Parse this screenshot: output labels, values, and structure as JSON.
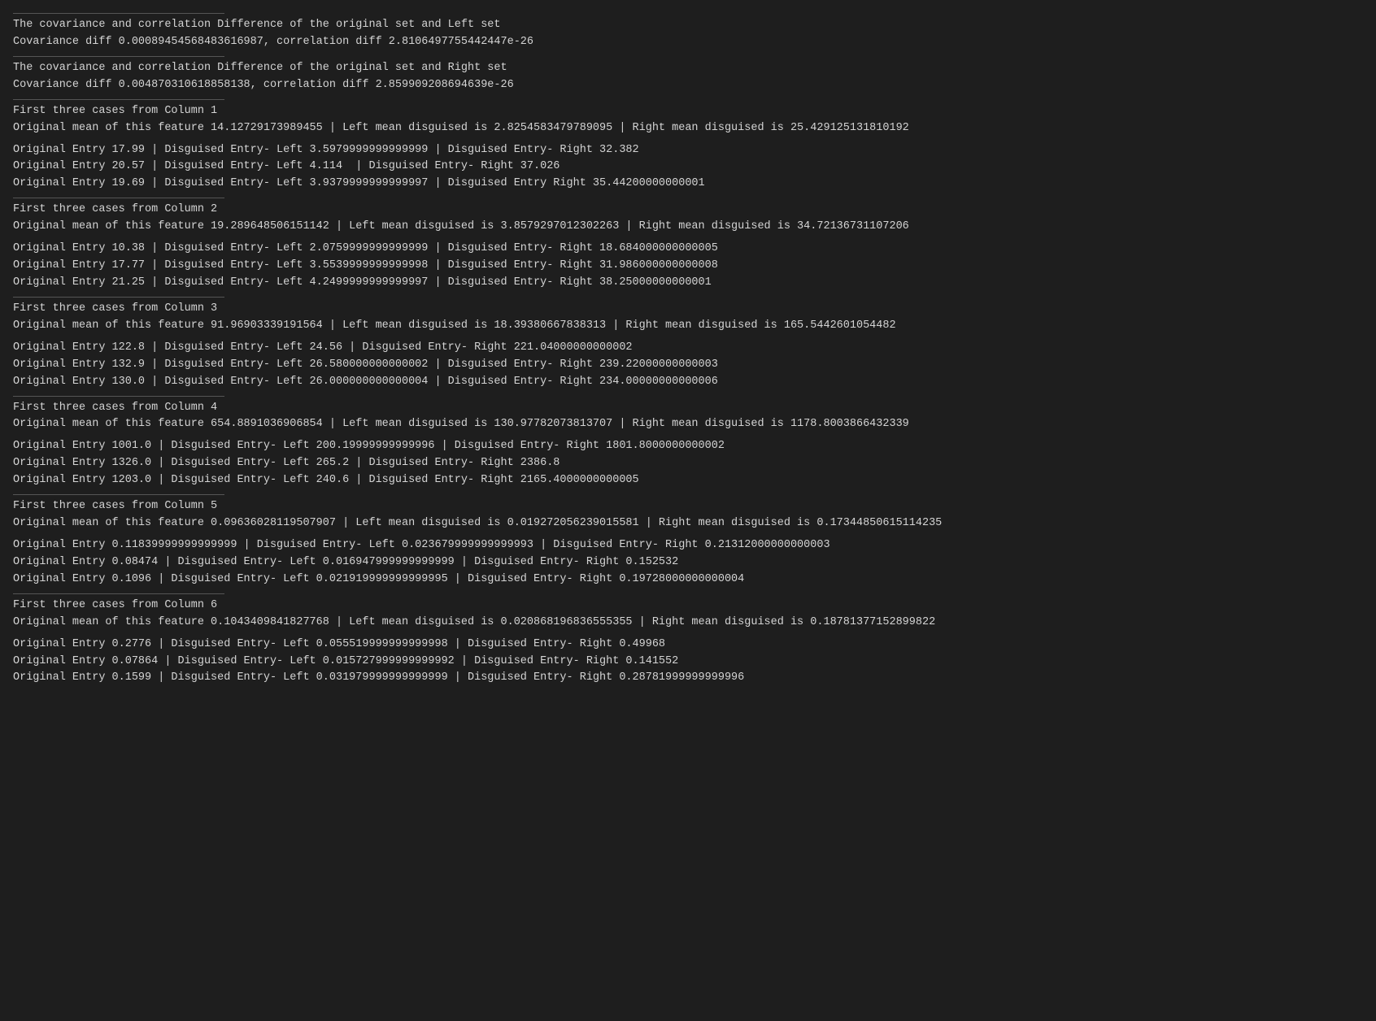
{
  "content": [
    {
      "type": "divider"
    },
    {
      "type": "line",
      "text": "The covariance and correlation Difference of the original set and Left set"
    },
    {
      "type": "line",
      "text": "Covariance diff 0.00089454568483616987, correlation diff 2.8106497755442447e-26"
    },
    {
      "type": "divider"
    },
    {
      "type": "line",
      "text": "The covariance and correlation Difference of the original set and Right set"
    },
    {
      "type": "line",
      "text": "Covariance diff 0.004870310618858138, correlation diff 2.859909208694639e-26"
    },
    {
      "type": "divider"
    },
    {
      "type": "line",
      "text": "First three cases from Column 1"
    },
    {
      "type": "line",
      "text": "Original mean of this feature 14.12729173989455 | Left mean disguised is 2.8254583479789095 | Right mean disguised is 25.429125131810192"
    },
    {
      "type": "gap"
    },
    {
      "type": "line",
      "text": "Original Entry 17.99 | Disguised Entry- Left 3.5979999999999999 | Disguised Entry- Right 32.382"
    },
    {
      "type": "line",
      "text": "Original Entry 20.57 | Disguised Entry- Left 4.114  | Disguised Entry- Right 37.026"
    },
    {
      "type": "line",
      "text": "Original Entry 19.69 | Disguised Entry- Left 3.9379999999999997 | Disguised Entry Right 35.44200000000001"
    },
    {
      "type": "divider"
    },
    {
      "type": "line",
      "text": "First three cases from Column 2"
    },
    {
      "type": "line",
      "text": "Original mean of this feature 19.289648506151142 | Left mean disguised is 3.8579297012302263 | Right mean disguised is 34.72136731107206"
    },
    {
      "type": "gap"
    },
    {
      "type": "line",
      "text": "Original Entry 10.38 | Disguised Entry- Left 2.0759999999999999 | Disguised Entry- Right 18.684000000000005"
    },
    {
      "type": "line",
      "text": "Original Entry 17.77 | Disguised Entry- Left 3.5539999999999998 | Disguised Entry- Right 31.986000000000008"
    },
    {
      "type": "line",
      "text": "Original Entry 21.25 | Disguised Entry- Left 4.2499999999999997 | Disguised Entry- Right 38.25000000000001"
    },
    {
      "type": "divider"
    },
    {
      "type": "line",
      "text": "First three cases from Column 3"
    },
    {
      "type": "line",
      "text": "Original mean of this feature 91.96903339191564 | Left mean disguised is 18.39380667838313 | Right mean disguised is 165.5442601054482"
    },
    {
      "type": "gap"
    },
    {
      "type": "line",
      "text": "Original Entry 122.8 | Disguised Entry- Left 24.56 | Disguised Entry- Right 221.04000000000002"
    },
    {
      "type": "line",
      "text": "Original Entry 132.9 | Disguised Entry- Left 26.580000000000002 | Disguised Entry- Right 239.22000000000003"
    },
    {
      "type": "line",
      "text": "Original Entry 130.0 | Disguised Entry- Left 26.000000000000004 | Disguised Entry- Right 234.00000000000006"
    },
    {
      "type": "divider"
    },
    {
      "type": "line",
      "text": "First three cases from Column 4"
    },
    {
      "type": "line",
      "text": "Original mean of this feature 654.8891036906854 | Left mean disguised is 130.97782073813707 | Right mean disguised is 1178.8003866432339"
    },
    {
      "type": "gap"
    },
    {
      "type": "line",
      "text": "Original Entry 1001.0 | Disguised Entry- Left 200.19999999999996 | Disguised Entry- Right 1801.8000000000002"
    },
    {
      "type": "line",
      "text": "Original Entry 1326.0 | Disguised Entry- Left 265.2 | Disguised Entry- Right 2386.8"
    },
    {
      "type": "line",
      "text": "Original Entry 1203.0 | Disguised Entry- Left 240.6 | Disguised Entry- Right 2165.4000000000005"
    },
    {
      "type": "divider"
    },
    {
      "type": "line",
      "text": "First three cases from Column 5"
    },
    {
      "type": "line",
      "text": "Original mean of this feature 0.09636028119507907 | Left mean disguised is 0.019272056239015581 | Right mean disguised is 0.17344850615114235"
    },
    {
      "type": "gap"
    },
    {
      "type": "line",
      "text": "Original Entry 0.11839999999999999 | Disguised Entry- Left 0.023679999999999993 | Disguised Entry- Right 0.21312000000000003"
    },
    {
      "type": "line",
      "text": "Original Entry 0.08474 | Disguised Entry- Left 0.016947999999999999 | Disguised Entry- Right 0.152532"
    },
    {
      "type": "line",
      "text": "Original Entry 0.1096 | Disguised Entry- Left 0.021919999999999995 | Disguised Entry- Right 0.19728000000000004"
    },
    {
      "type": "divider"
    },
    {
      "type": "line",
      "text": "First three cases from Column 6"
    },
    {
      "type": "line",
      "text": "Original mean of this feature 0.1043409841827768 | Left mean disguised is 0.020868196836555355 | Right mean disguised is 0.18781377152899822"
    },
    {
      "type": "gap"
    },
    {
      "type": "line",
      "text": "Original Entry 0.2776 | Disguised Entry- Left 0.055519999999999998 | Disguised Entry- Right 0.49968"
    },
    {
      "type": "line",
      "text": "Original Entry 0.07864 | Disguised Entry- Left 0.015727999999999992 | Disguised Entry- Right 0.141552"
    },
    {
      "type": "line",
      "text": "Original Entry 0.1599 | Disguised Entry- Left 0.031979999999999999 | Disguised Entry- Right 0.28781999999999996"
    }
  ]
}
